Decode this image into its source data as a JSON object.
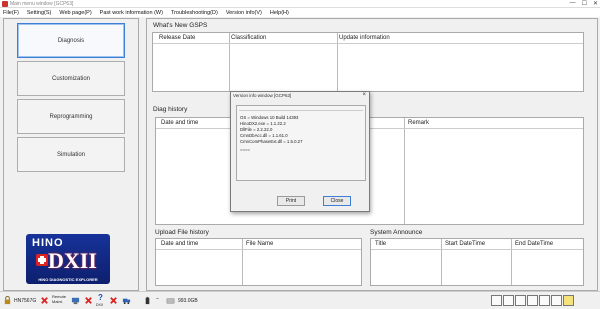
{
  "window": {
    "title": "Main menu window [GCP63]",
    "controls": [
      "—",
      "☐",
      "✕"
    ]
  },
  "menu": [
    "File(F)",
    "Setting(S)",
    "Web page(P)",
    "Past work information (W)",
    "Troubleshooting(D)",
    "Version info(V)",
    "Help(H)"
  ],
  "nav": [
    "Diagnosis",
    "Customization",
    "Reprogramming",
    "Simulation"
  ],
  "logo": {
    "brand": "HINO",
    "product": "DXII",
    "subtitle": "HINO DIAGNOSTIC EXPLORER"
  },
  "sections": {
    "whats_new": {
      "title": "What's New GSPS",
      "columns": [
        "Release Date",
        "Classification",
        "Update information"
      ]
    },
    "diag_history": {
      "title": "Diag history",
      "columns": [
        "Date and time",
        "Remark"
      ]
    },
    "upload_history": {
      "title": "Upload File history",
      "columns": [
        "Date and time",
        "File Name"
      ]
    },
    "system_announce": {
      "title": "System Announce",
      "columns": [
        "Title",
        "Start DateTime",
        "End DateTime"
      ]
    }
  },
  "dialog": {
    "title": "Version info window [GCP63]",
    "lines": [
      "OS = Windows 10 Build 14393",
      "HinoDX2.exe = 1.1.22.2",
      "DllFile = 2.2.22.0",
      "CmnDbAcc.dll = 1.1.61.0",
      "CmnComPhaseExt.dll = 1.5.0.27",
      "===="
    ],
    "print_label": "Print",
    "close_label": "Close"
  },
  "status": {
    "user": "HN7567G",
    "remote_label": "Remote Maint.",
    "help_label": "DXII",
    "disk": "993.0GB"
  }
}
